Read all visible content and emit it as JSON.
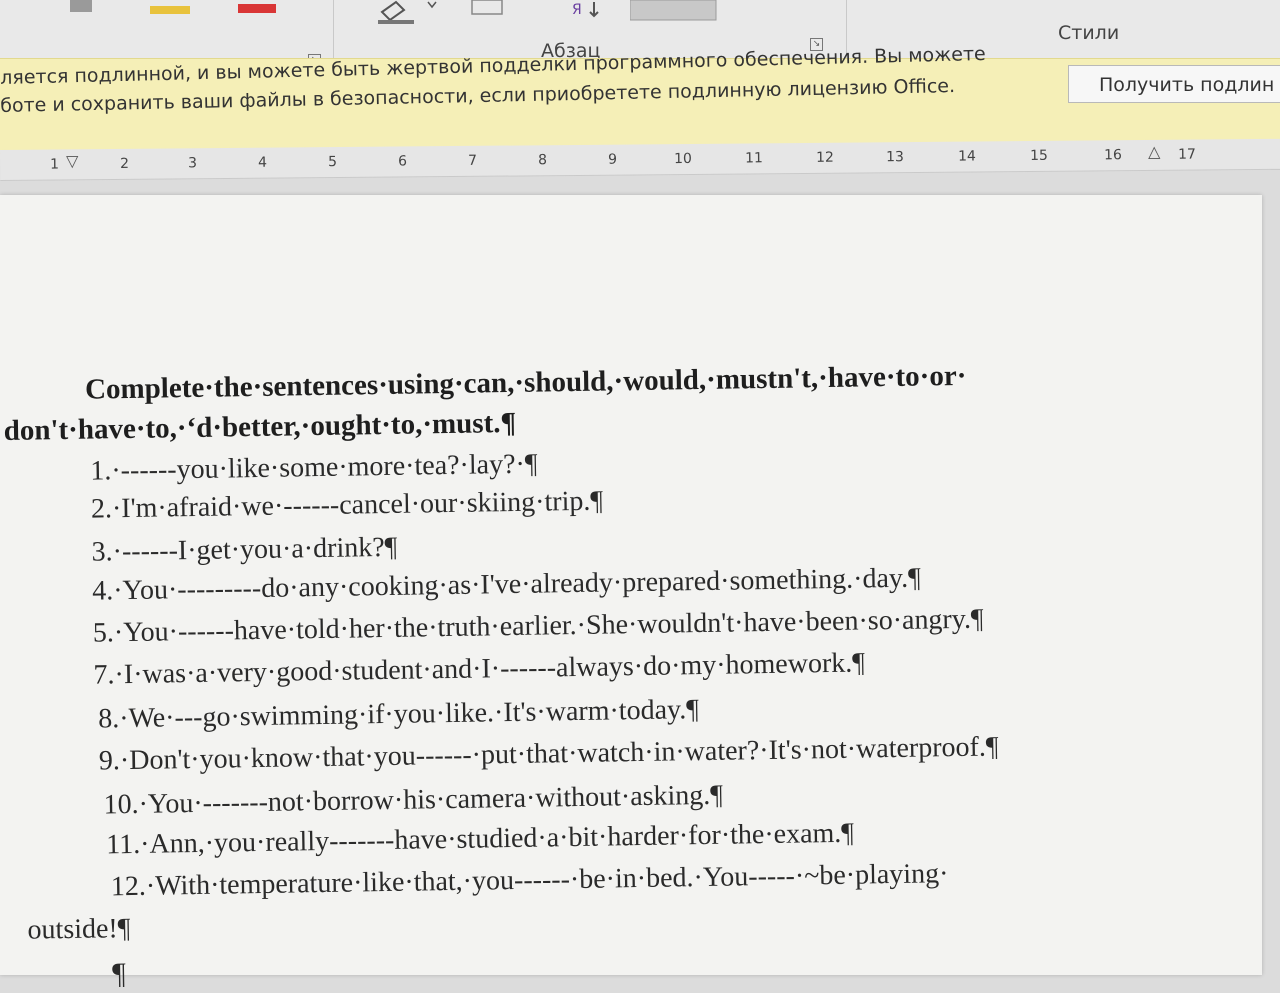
{
  "ribbon": {
    "paragraph_group_label": "Абзац",
    "styles_group_label": "Стили"
  },
  "warning_bar": {
    "line1": "ляется подлинной, и вы можете быть жертвой подделки программного обеспечения. Вы можете",
    "line2": "боте и сохранить ваши файлы в безопасности, если приобретете подлинную лицензию Office.",
    "button_label": "Получить подлин"
  },
  "ruler": {
    "numbers": [
      "1",
      "2",
      "3",
      "4",
      "5",
      "6",
      "7",
      "8",
      "9",
      "10",
      "11",
      "12",
      "13",
      "14",
      "15",
      "16",
      "17"
    ]
  },
  "document": {
    "heading_line1": "Complete·the·sentences·using·can,·should,·would,·mustn't,·have·to·or·",
    "heading_line2": "don't·have·to,·‘d·better,·ought·to,·must.¶",
    "lines": [
      "1.·------you·like·some·more·tea?·lay?·¶",
      "2.·I'm·afraid·we·------cancel·our·skiing·trip.¶",
      "3.·------I·get·you·a·drink?¶",
      "4.·You·---------do·any·cooking·as·I've·already·prepared·something.·day.¶",
      "5.·You·------have·told·her·the·truth·earlier.·She·wouldn't·have·been·so·angry.¶",
      "7.·I·was·a·very·good·student·and·I·------always·do·my·homework.¶",
      "8.·We·---go·swimming·if·you·like.·It's·warm·today.¶",
      "9.·Don't·you·know·that·you------·put·that·watch·in·water?·It's·not·waterproof.¶",
      "10.·You·-------not·borrow·his·camera·without·asking.¶",
      "11.·Ann,·you·really-------have·studied·a·bit·harder·for·the·exam.¶",
      "12.·With·temperature·like·that,·you------·be·in·bed.·You-----·~be·playing·"
    ],
    "last_line": "outside!¶",
    "empty_paragraph": "¶"
  }
}
